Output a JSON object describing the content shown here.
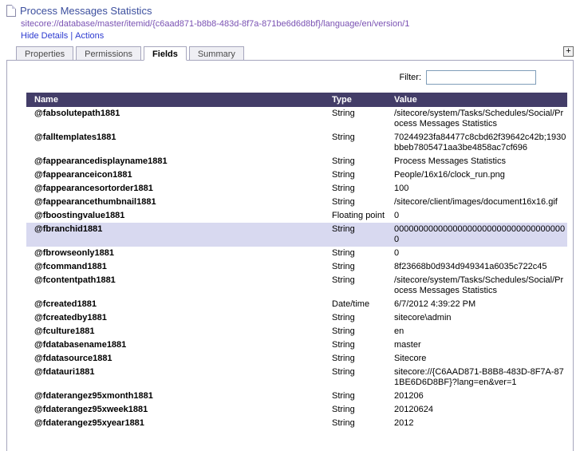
{
  "colors": {
    "table_header_bg": "#433d68",
    "highlight_row_bg": "#d8d9f0",
    "title_color": "#3c4f9e",
    "uri_color": "#7a52b3",
    "link_color": "#2d3bd0"
  },
  "header": {
    "title": "Process Messages Statistics",
    "uri": "sitecore://database/master/itemid/{c6aad871-b8b8-483d-8f7a-871be6d6d8bf}/language/en/version/1",
    "links": [
      "Hide Details",
      "Actions"
    ],
    "separator": "|"
  },
  "tabs": [
    {
      "label": "Properties",
      "active": false
    },
    {
      "label": "Permissions",
      "active": false
    },
    {
      "label": "Fields",
      "active": true
    },
    {
      "label": "Summary",
      "active": false
    }
  ],
  "expand_button": "+",
  "filter": {
    "label": "Filter:",
    "value": ""
  },
  "table": {
    "columns": [
      "Name",
      "Type",
      "Value"
    ],
    "rows": [
      {
        "name": "@fabsolutepath1881",
        "type": "String",
        "value": "/sitecore/system/Tasks/Schedules/Social/Process Messages Statistics",
        "highlight": false
      },
      {
        "name": "@falltemplates1881",
        "type": "String",
        "value": "70244923fa84477c8cbd62f39642c42b;1930bbeb7805471aa3be4858ac7cf696",
        "highlight": false
      },
      {
        "name": "@fappearancedisplayname1881",
        "type": "String",
        "value": "Process Messages Statistics",
        "highlight": false
      },
      {
        "name": "@fappearanceicon1881",
        "type": "String",
        "value": "People/16x16/clock_run.png",
        "highlight": false
      },
      {
        "name": "@fappearancesortorder1881",
        "type": "String",
        "value": "100",
        "highlight": false
      },
      {
        "name": "@fappearancethumbnail1881",
        "type": "String",
        "value": "/sitecore/client/images/document16x16.gif",
        "highlight": false
      },
      {
        "name": "@fboostingvalue1881",
        "type": "Floating point",
        "value": "0",
        "highlight": false
      },
      {
        "name": "@fbranchid1881",
        "type": "String",
        "value": "000000000000000000000000000000000000",
        "highlight": true
      },
      {
        "name": "@fbrowseonly1881",
        "type": "String",
        "value": "0",
        "highlight": false
      },
      {
        "name": "@fcommand1881",
        "type": "String",
        "value": "8f23668b0d934d949341a6035c722c45",
        "highlight": false
      },
      {
        "name": "@fcontentpath1881",
        "type": "String",
        "value": "/sitecore/system/Tasks/Schedules/Social/Process Messages Statistics",
        "highlight": false
      },
      {
        "name": "@fcreated1881",
        "type": "Date/time",
        "value": "6/7/2012 4:39:22 PM",
        "highlight": false
      },
      {
        "name": "@fcreatedby1881",
        "type": "String",
        "value": "sitecore\\admin",
        "highlight": false
      },
      {
        "name": "@fculture1881",
        "type": "String",
        "value": "en",
        "highlight": false
      },
      {
        "name": "@fdatabasename1881",
        "type": "String",
        "value": "master",
        "highlight": false
      },
      {
        "name": "@fdatasource1881",
        "type": "String",
        "value": "Sitecore",
        "highlight": false
      },
      {
        "name": "@fdatauri1881",
        "type": "String",
        "value": "sitecore://{C6AAD871-B8B8-483D-8F7A-871BE6D6D8BF}?lang=en&ver=1",
        "highlight": false
      },
      {
        "name": "@fdaterangez95xmonth1881",
        "type": "String",
        "value": "201206",
        "highlight": false
      },
      {
        "name": "@fdaterangez95xweek1881",
        "type": "String",
        "value": "20120624",
        "highlight": false
      },
      {
        "name": "@fdaterangez95xyear1881",
        "type": "String",
        "value": "2012",
        "highlight": false
      }
    ]
  }
}
